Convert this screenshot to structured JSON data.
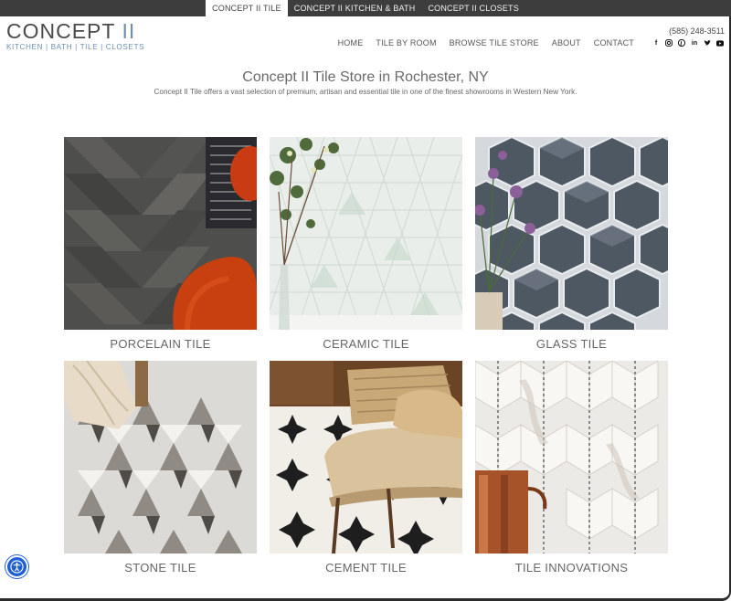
{
  "topbar": {
    "tabs": [
      "CONCEPT II TILE",
      "CONCEPT II KITCHEN & BATH",
      "CONCEPT II CLOSETS"
    ]
  },
  "logo": {
    "word": "CONCEPT",
    "numeral": "II",
    "tagline": "KITCHEN | BATH | TILE | CLOSETS"
  },
  "header": {
    "phone": "(585) 248-3511",
    "nav": [
      "HOME",
      "TILE BY ROOM",
      "BROWSE TILE STORE",
      "ABOUT",
      "CONTACT"
    ],
    "social_icons": [
      "facebook-icon",
      "instagram-icon",
      "pinterest-icon",
      "linkedin-icon",
      "twitter-icon",
      "youtube-icon"
    ]
  },
  "main": {
    "title": "Concept II Tile Store in Rochester, NY",
    "subtitle": "Concept II Tile offers a vast selection of premium, artisan and essential tile in one of the finest showrooms in Western New York.",
    "tiles": [
      {
        "label": "PORCELAIN TILE"
      },
      {
        "label": "CERAMIC TILE"
      },
      {
        "label": "GLASS TILE"
      },
      {
        "label": "STONE TILE"
      },
      {
        "label": "CEMENT TILE"
      },
      {
        "label": "TILE INNOVATIONS"
      }
    ]
  },
  "colors": {
    "topbar": "#3d3d3d",
    "brand_blue": "#6d8fb0",
    "accessibility": "#1f5fd6"
  }
}
